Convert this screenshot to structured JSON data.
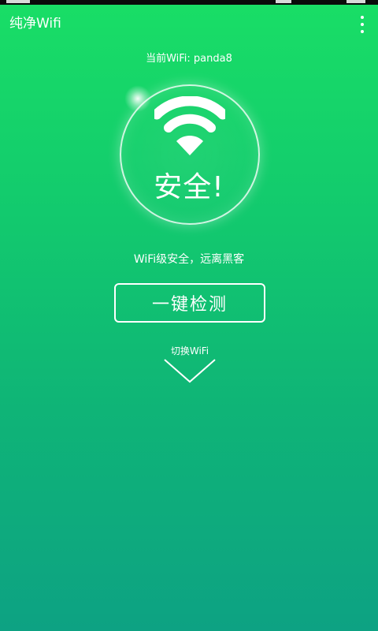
{
  "app": {
    "title": "纯净Wifi"
  },
  "header": {
    "current_wifi": "当前WiFi: panda8"
  },
  "status": {
    "icon": "wifi-icon",
    "text": "安全!",
    "message": "WiFi级安全，远离黑客"
  },
  "actions": {
    "check_label": "一键检测",
    "switch_label": "切换WiFi",
    "switch_icon": "chevron-down-icon"
  },
  "colors": {
    "background_top": "#19de66",
    "background_bottom": "#0da283",
    "foreground": "#ffffff"
  }
}
